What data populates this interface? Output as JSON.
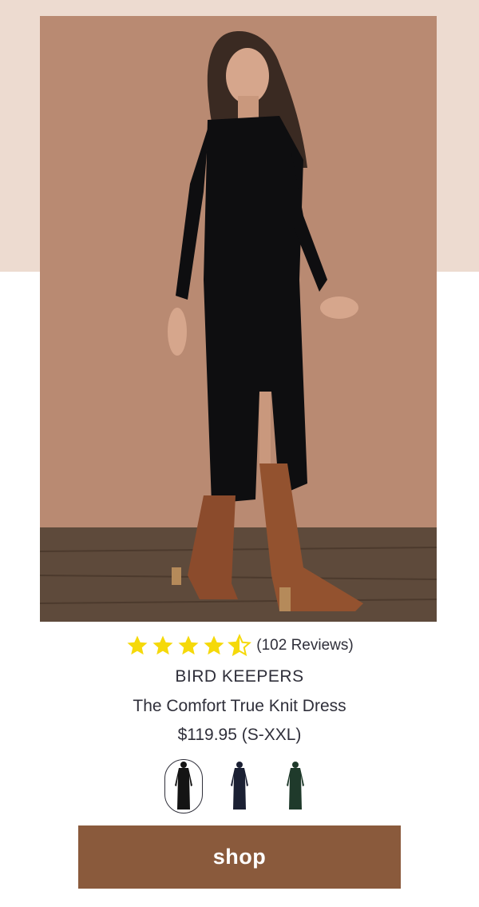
{
  "rating": {
    "stars_value": 4.5,
    "stars_max": 5,
    "review_count_text": "(102 Reviews)",
    "star_color": "#f5d90a"
  },
  "product": {
    "brand": "BIRD KEEPERS",
    "name": "The Comfort True Knit Dress",
    "price": "$119.95 (S-XXL)",
    "image_icon": "model-wearing-black-knit-dress-photo"
  },
  "swatches": [
    {
      "color_name": "black",
      "color": "#141414",
      "selected": true
    },
    {
      "color_name": "navy",
      "color": "#1b2033",
      "selected": false
    },
    {
      "color_name": "dark-green",
      "color": "#1f3a2b",
      "selected": false
    }
  ],
  "cta": {
    "label": "shop",
    "color": "#8a5a3c"
  },
  "colors": {
    "top_band": "#eddbd0",
    "photo_backdrop": "#b98a72",
    "text": "#2f2f3a"
  }
}
